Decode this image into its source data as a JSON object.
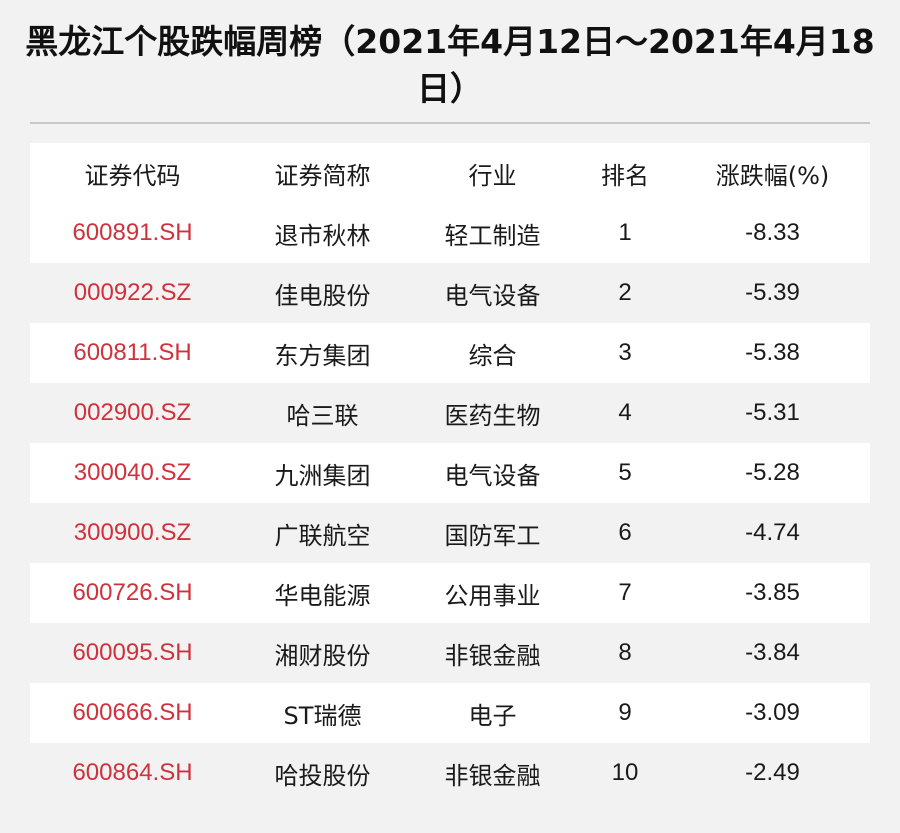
{
  "title": "黑龙江个股跌幅周榜（2021年4月12日～2021年4月18日）",
  "table": {
    "headers": [
      "证券代码",
      "证券简称",
      "行业",
      "排名",
      "涨跌幅(%)"
    ],
    "rows": [
      {
        "code": "600891.SH",
        "name": "退市秋林",
        "industry": "轻工制造",
        "rank": "1",
        "change": "-8.33"
      },
      {
        "code": "000922.SZ",
        "name": "佳电股份",
        "industry": "电气设备",
        "rank": "2",
        "change": "-5.39"
      },
      {
        "code": "600811.SH",
        "name": "东方集团",
        "industry": "综合",
        "rank": "3",
        "change": "-5.38"
      },
      {
        "code": "002900.SZ",
        "name": "哈三联",
        "industry": "医药生物",
        "rank": "4",
        "change": "-5.31"
      },
      {
        "code": "300040.SZ",
        "name": "九洲集团",
        "industry": "电气设备",
        "rank": "5",
        "change": "-5.28"
      },
      {
        "code": "300900.SZ",
        "name": "广联航空",
        "industry": "国防军工",
        "rank": "6",
        "change": "-4.74"
      },
      {
        "code": "600726.SH",
        "name": "华电能源",
        "industry": "公用事业",
        "rank": "7",
        "change": "-3.85"
      },
      {
        "code": "600095.SH",
        "name": "湘财股份",
        "industry": "非银金融",
        "rank": "8",
        "change": "-3.84"
      },
      {
        "code": "600666.SH",
        "name": "ST瑞德",
        "industry": "电子",
        "rank": "9",
        "change": "-3.09"
      },
      {
        "code": "600864.SH",
        "name": "哈投股份",
        "industry": "非银金融",
        "rank": "10",
        "change": "-2.49"
      }
    ]
  },
  "colors": {
    "code_text": "#d0323c",
    "row_alt": "#f2f2f2",
    "row_main": "#ffffff"
  }
}
